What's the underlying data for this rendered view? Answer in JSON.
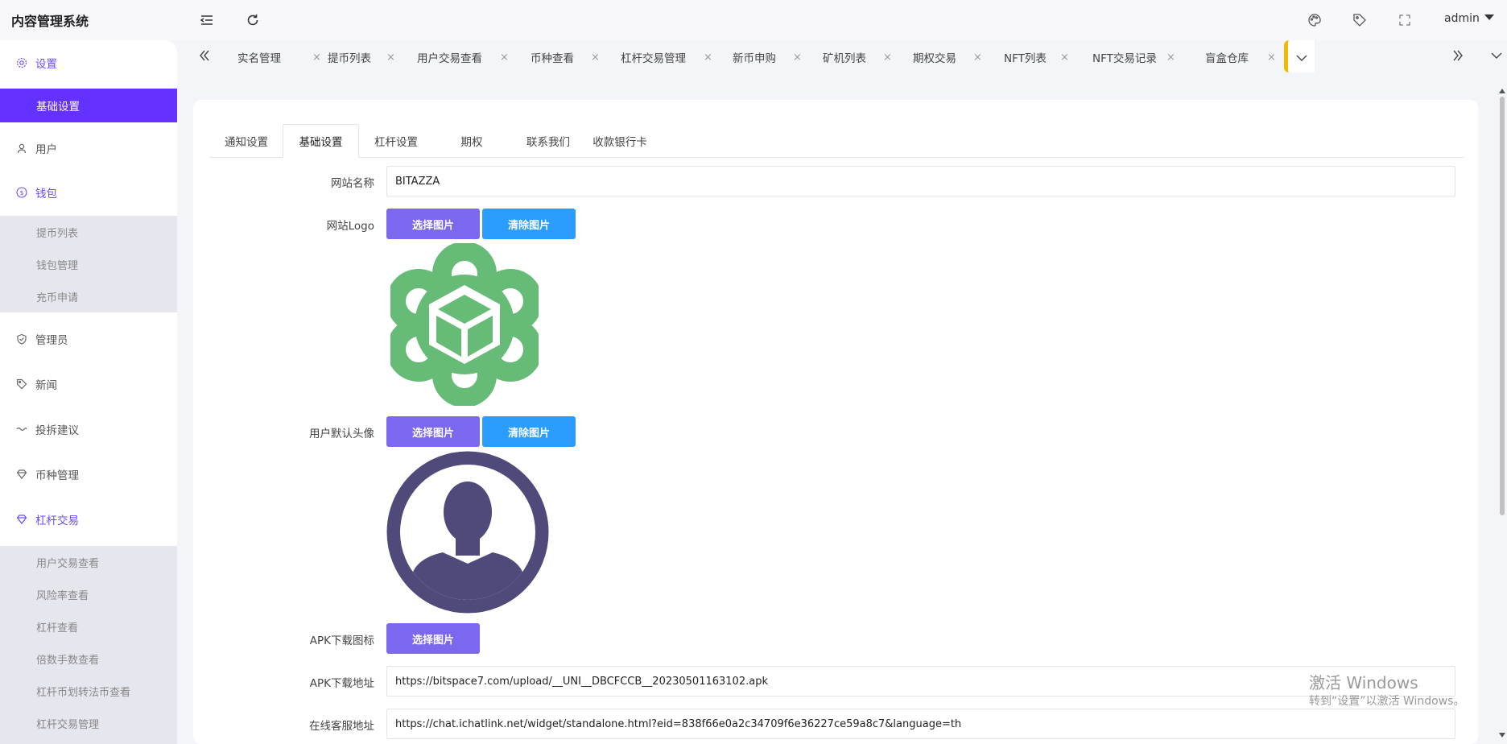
{
  "app": {
    "title": "内容管理系统"
  },
  "topbar": {
    "user": "admin"
  },
  "sidebar": {
    "settings": "设置",
    "settings_sub": [
      "基础设置"
    ],
    "user": "用户",
    "wallet": "钱包",
    "wallet_sub": [
      "提币列表",
      "钱包管理",
      "充币申请"
    ],
    "admin": "管理员",
    "news": "新闻",
    "complaints": "投拆建议",
    "coins": "币种管理",
    "leverage": "杠杆交易",
    "leverage_sub": [
      "用户交易查看",
      "风险率查看",
      "杠杆查看",
      "倍数手数查看",
      "杠杆币划转法币查看",
      "杠杆交易管理"
    ]
  },
  "tabs": [
    "实名管理",
    "提币列表",
    "用户交易查看",
    "币种查看",
    "杠杆交易管理",
    "新币申购",
    "矿机列表",
    "期权交易",
    "NFT列表",
    "NFT交易记录",
    "盲盒仓库"
  ],
  "subtabs": [
    "通知设置",
    "基础设置",
    "杠杆设置",
    "期权",
    "联系我们",
    "收款银行卡"
  ],
  "form": {
    "site_name_label": "网站名称",
    "site_name_value": "BITAZZA",
    "logo_label": "网站Logo",
    "avatar_label": "用户默认头像",
    "apk_icon_label": "APK下载图标",
    "apk_url_label": "APK下载地址",
    "apk_url_value": "https://bitspace7.com/upload/__UNI__DBCFCCB__20230501163102.apk",
    "service_url_label": "在线客服地址",
    "service_url_value": "https://chat.ichatlink.net/widget/standalone.html?eid=838f66e0a2c34709f6e36227ce59a8c7&language=th",
    "pick_label": "选择图片",
    "clear_label": "清除图片"
  },
  "watermark": {
    "line1": "激活 Windows",
    "line2": "转到“设置”以激活 Windows。"
  },
  "colors": {
    "accent": "#6531ff",
    "pick_button": "#7b68ee",
    "clear_button": "#2a9dff",
    "logo_green": "#66bb77",
    "avatar": "#4f4a7a",
    "tab_marker": "#f5b800"
  }
}
